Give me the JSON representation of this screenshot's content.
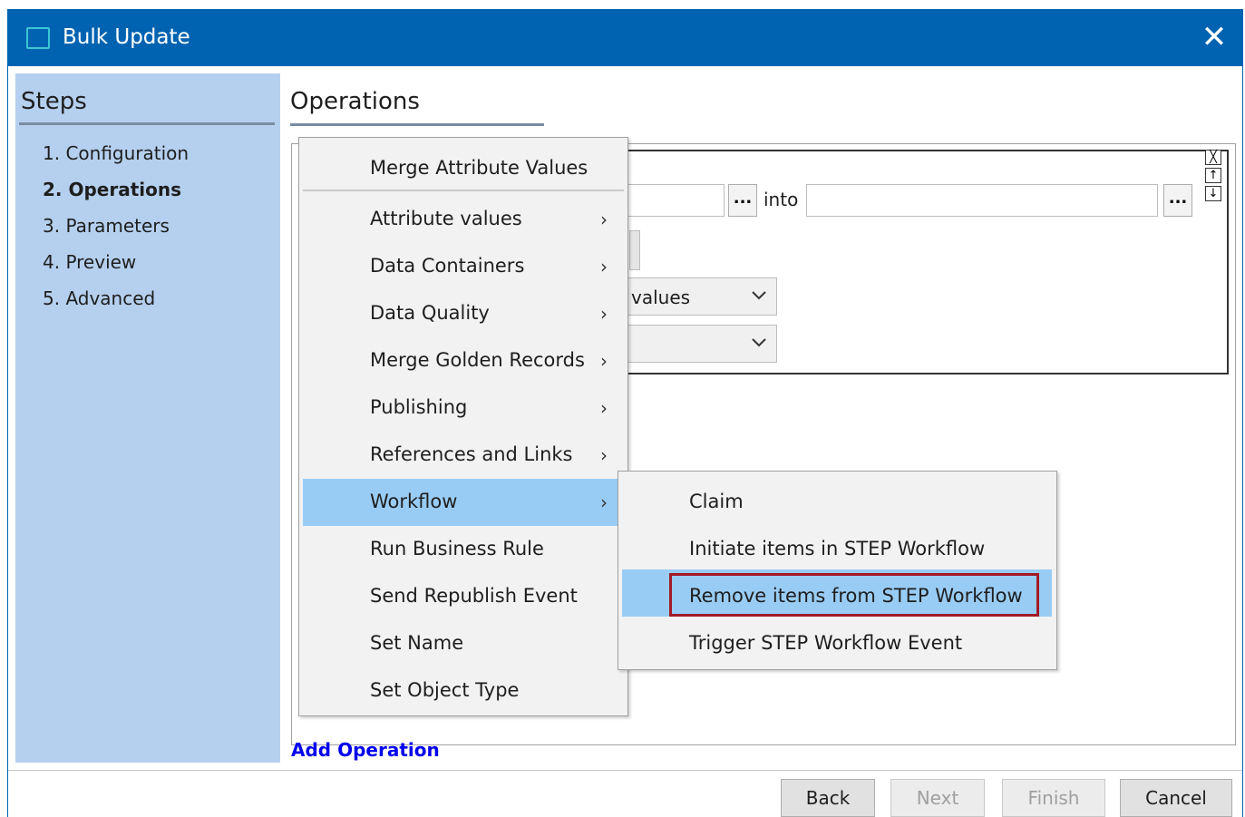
{
  "window": {
    "title": "Bulk Update",
    "close_glyph": "✕"
  },
  "steps": {
    "heading": "Steps",
    "items": [
      {
        "label": "1. Configuration",
        "active": false
      },
      {
        "label": "2. Operations",
        "active": true
      },
      {
        "label": "3. Parameters",
        "active": false
      },
      {
        "label": "4. Preview",
        "active": false
      },
      {
        "label": "5. Advanced",
        "active": false
      }
    ]
  },
  "operations": {
    "heading": "Operations",
    "into_label": "into",
    "ellipsis": "...",
    "dropdown1_value": "values",
    "add_operation": "Add Operation",
    "panel_buttons": {
      "remove": "╳",
      "up": "↑",
      "down": "↓"
    }
  },
  "menu": {
    "items": [
      {
        "label": "Merge Attribute Values",
        "submenu": false
      },
      {
        "label": "Attribute values",
        "submenu": true
      },
      {
        "label": "Data Containers",
        "submenu": true
      },
      {
        "label": "Data Quality",
        "submenu": true
      },
      {
        "label": "Merge Golden Records",
        "submenu": true
      },
      {
        "label": "Publishing",
        "submenu": true
      },
      {
        "label": "References and Links",
        "submenu": true
      },
      {
        "label": "Workflow",
        "submenu": true,
        "highlighted": true
      },
      {
        "label": "Run Business Rule",
        "submenu": false
      },
      {
        "label": "Send Republish Event",
        "submenu": false
      },
      {
        "label": "Set Name",
        "submenu": false
      },
      {
        "label": "Set Object Type",
        "submenu": false
      }
    ],
    "chevron": "›"
  },
  "submenu": {
    "items": [
      {
        "label": "Claim"
      },
      {
        "label": "Initiate items in STEP Workflow"
      },
      {
        "label": "Remove items from STEP Workflow",
        "highlighted": true,
        "outlined": true
      },
      {
        "label": "Trigger STEP Workflow Event"
      }
    ]
  },
  "footer": {
    "back": "Back",
    "next": "Next",
    "finish": "Finish",
    "cancel": "Cancel"
  },
  "colors": {
    "titlebar": "#0063b1",
    "steps_panel": "#b5d0ef",
    "menu_highlight": "#99ccf5",
    "outline_red": "#a11a26",
    "link": "#0000ee"
  }
}
